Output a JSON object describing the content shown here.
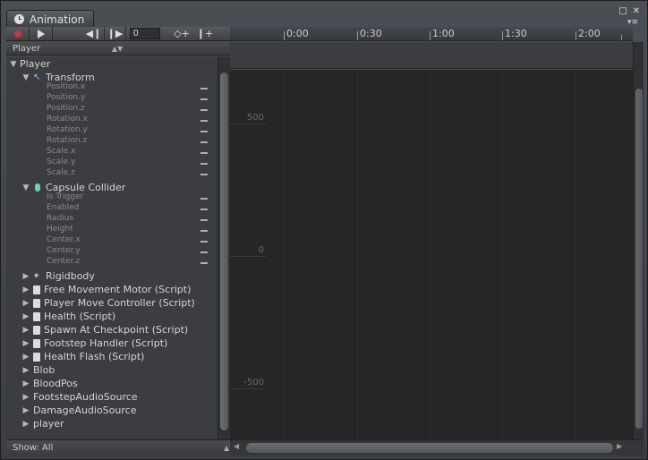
{
  "window": {
    "tab_title": "Animation",
    "tab_icon": "clock-icon"
  },
  "toolbar": {
    "frame_value": "0"
  },
  "ruler": {
    "ticks": [
      "0:00",
      "0:30",
      "1:00",
      "1:30",
      "2:00"
    ]
  },
  "hierarchy": {
    "header": "Player",
    "root": "Player",
    "transform": {
      "label": "Transform",
      "props": [
        "Position.x",
        "Position.y",
        "Position.z",
        "Rotation.x",
        "Rotation.y",
        "Rotation.z",
        "Scale.x",
        "Scale.y",
        "Scale.z"
      ]
    },
    "capsule": {
      "label": "Capsule Collider",
      "props": [
        "Is Trigger",
        "Enabled",
        "Radius",
        "Height",
        "Center.x",
        "Center.y",
        "Center.z"
      ]
    },
    "components": [
      {
        "label": "Rigidbody",
        "icon": "rigidbody-icon"
      },
      {
        "label": "Free Movement Motor (Script)",
        "icon": "script-icon"
      },
      {
        "label": "Player Move Controller (Script)",
        "icon": "script-icon"
      },
      {
        "label": "Health (Script)",
        "icon": "script-icon"
      },
      {
        "label": "Spawn At Checkpoint (Script)",
        "icon": "script-icon"
      },
      {
        "label": "Footstep Handler (Script)",
        "icon": "script-icon"
      },
      {
        "label": "Health Flash (Script)",
        "icon": "script-icon"
      }
    ],
    "children": [
      "Blob",
      "BloodPos",
      "FootstepAudioSource",
      "DamageAudioSource",
      "player"
    ]
  },
  "show": {
    "label": "Show: All"
  },
  "curve": {
    "y_labels": [
      "500",
      "0",
      "-500"
    ]
  }
}
